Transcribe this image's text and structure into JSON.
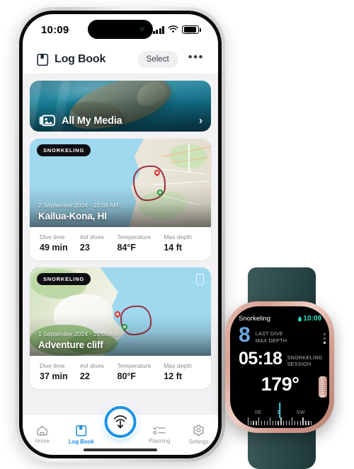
{
  "phone": {
    "status_bar": {
      "time": "10:09",
      "icons": [
        "cellular-signal-icon",
        "wifi-icon",
        "battery-icon"
      ]
    },
    "nav": {
      "icon": "log-book-icon",
      "title": "Log Book",
      "select_label": "Select",
      "more_label": "•••"
    },
    "media_banner": {
      "icon": "photo-stack-icon",
      "label": "All My Media",
      "chevron": "›"
    },
    "dives": [
      {
        "badge": "SNORKELING",
        "date": "2 September 2024 - 10:09 AM",
        "place": "Kailua-Kona, HI",
        "has_device_badge": false,
        "stats": [
          {
            "key": "Dive time",
            "value": "49 min"
          },
          {
            "key": "#of dives",
            "value": "23"
          },
          {
            "key": "Temperature",
            "value": "84°F"
          },
          {
            "key": "Max depth",
            "value": "14 ft"
          }
        ]
      },
      {
        "badge": "SNORKELING",
        "date": "1 September 2024 - 10:03 AM",
        "place": "Adventure cliff",
        "has_device_badge": true,
        "stats": [
          {
            "key": "Dive time",
            "value": "37 min"
          },
          {
            "key": "#of dives",
            "value": "22"
          },
          {
            "key": "Temperature",
            "value": "80°F"
          },
          {
            "key": "Max depth",
            "value": "12 ft"
          }
        ]
      }
    ],
    "tabbar": {
      "items": [
        {
          "label": "Home",
          "icon": "home-icon",
          "active": false
        },
        {
          "label": "Log Book",
          "icon": "book-icon",
          "active": true
        },
        {
          "label": "",
          "icon": "dive-start-icon",
          "active": false
        },
        {
          "label": "Planning",
          "icon": "checklist-icon",
          "active": false
        },
        {
          "label": "Settings",
          "icon": "gear-icon",
          "active": false
        }
      ],
      "active_color": "#1c8ae0",
      "inactive_color": "#9a9aa1"
    }
  },
  "watch": {
    "app_name": "Snorkeling",
    "time": "10:09",
    "time_icon": "water-droplet-icon",
    "metrics": [
      {
        "value": "8",
        "label_line1": "LAST DIVE",
        "label_line2": "MAX DEPTH",
        "color": "#6ba8de"
      },
      {
        "value": "05:18",
        "label_line1": "SNORKELING",
        "label_line2": "SESSION",
        "color": "#ffffff"
      }
    ],
    "heading": "179°",
    "compass": {
      "directions": [
        "SE",
        "S",
        "SW"
      ],
      "current": "S",
      "needle_color": "#2fd0e0"
    },
    "page_dots": 3,
    "active_dot": 3
  }
}
